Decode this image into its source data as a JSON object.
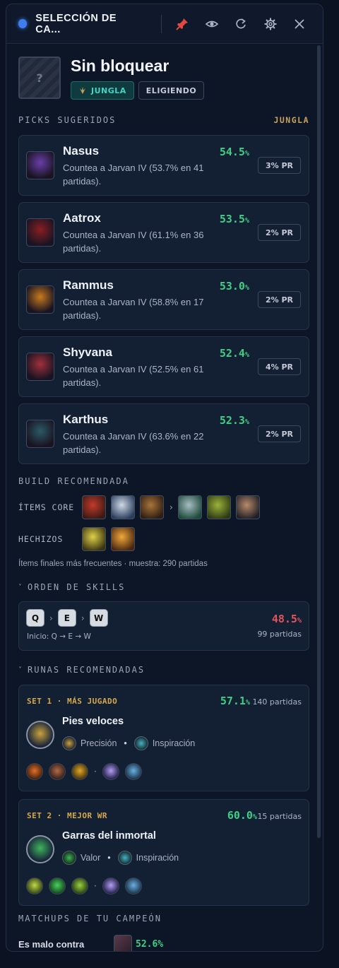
{
  "window": {
    "title": "SELECCIÓN DE CA..."
  },
  "champion": {
    "name": "Sin bloquear",
    "portrait_glyph": "?",
    "role_tag": "JUNGLA",
    "state_tag": "ELIGIENDO"
  },
  "picks": {
    "label": "PICKS SUGERIDOS",
    "role": "JUNGLA",
    "items": [
      {
        "name": "Nasus",
        "desc": "Countea a Jarvan IV (53.7% en 41 partidas).",
        "wr": "54.5",
        "pct": "%",
        "pr": "3% PR",
        "color": "#6a3fa8"
      },
      {
        "name": "Aatrox",
        "desc": "Countea a Jarvan IV (61.1% en 36 partidas).",
        "wr": "53.5",
        "pct": "%",
        "pr": "2% PR",
        "color": "#8a1e22"
      },
      {
        "name": "Rammus",
        "desc": "Countea a Jarvan IV (58.8% en 17 partidas).",
        "wr": "53.0",
        "pct": "%",
        "pr": "2% PR",
        "color": "#c87a1c"
      },
      {
        "name": "Shyvana",
        "desc": "Countea a Jarvan IV (52.5% en 61 partidas).",
        "wr": "52.4",
        "pct": "%",
        "pr": "4% PR",
        "color": "#a0303a"
      },
      {
        "name": "Karthus",
        "desc": "Countea a Jarvan IV (63.6% en 22 partidas).",
        "wr": "52.3",
        "pct": "%",
        "pr": "2% PR",
        "color": "#2a5a66"
      }
    ]
  },
  "build": {
    "label": "BUILD RECOMENDADA",
    "core_label": "ÍTEMS CORE",
    "spells_label": "HECHIZOS",
    "core_items": [
      "item-red-shield",
      "item-white-blade",
      "item-bronze-boots"
    ],
    "final_items": [
      "item-silver-crown",
      "item-green-axe",
      "item-dark-sword"
    ],
    "spells": [
      "spell-smite",
      "spell-flash"
    ],
    "arrow": "›",
    "note": "Ítems finales más frecuentes · muestra: 290 partidas"
  },
  "skills": {
    "label": "ORDEN DE SKILLS",
    "chevron": "˅",
    "keys": [
      "Q",
      "E",
      "W"
    ],
    "sep": "›",
    "start": "Inicio: Q → E → W",
    "wr": "48.5",
    "pct": "%",
    "games": "99 partidas"
  },
  "runes": {
    "label": "RUNAS RECOMENDADAS",
    "chevron": "˅",
    "bullet": "•",
    "dot": "·",
    "sets": [
      {
        "tag": "SET 1 · MÁS JUGADO",
        "wr": "57.1",
        "pct": "%",
        "games": "140 partidas",
        "keystone": "Pies veloces",
        "primary": "Precisión",
        "secondary": "Inspiración",
        "accent": "#c9a23c"
      },
      {
        "tag": "SET 2 · MEJOR WR",
        "wr": "60.0",
        "pct": "%",
        "games": "15 partidas",
        "keystone": "Garras del inmortal",
        "primary": "Valor",
        "secondary": "Inspiración",
        "accent": "#3fb55a"
      }
    ]
  },
  "matchups": {
    "label": "MATCHUPS DE TU CAMPEÓN",
    "bad_label": "Es malo contra",
    "bad_wr": "52.6%"
  },
  "colors": {
    "accent_green": "#3fcf84",
    "accent_red": "#e0545a",
    "gold": "#d6a84c",
    "teal": "#3fd4c4"
  }
}
